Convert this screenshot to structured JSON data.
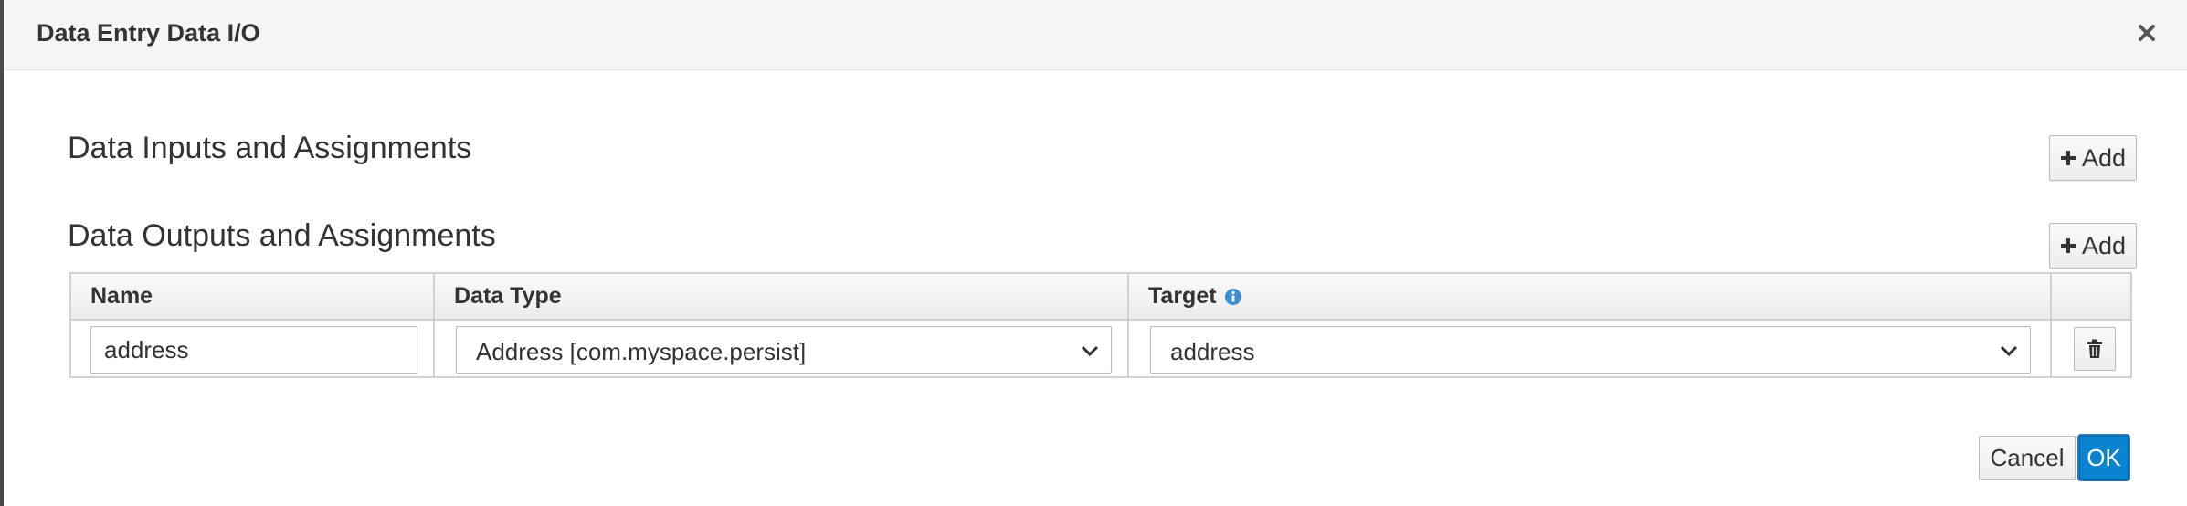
{
  "dialog": {
    "title": "Data Entry Data I/O",
    "close_icon": "close-icon"
  },
  "inputs_section": {
    "title": "Data Inputs and Assignments",
    "add_label": "Add"
  },
  "outputs_section": {
    "title": "Data Outputs and Assignments",
    "add_label": "Add",
    "columns": [
      "Name",
      "Data Type",
      "Target"
    ],
    "rows": [
      {
        "name": "address",
        "data_type": "Address [com.myspace.persist]",
        "target": "address"
      }
    ]
  },
  "footer": {
    "cancel_label": "Cancel",
    "ok_label": "OK"
  },
  "colors": {
    "primary": "#0a83d0",
    "info_icon": "#3d8ed1",
    "header_bg": "#f5f5f5"
  }
}
